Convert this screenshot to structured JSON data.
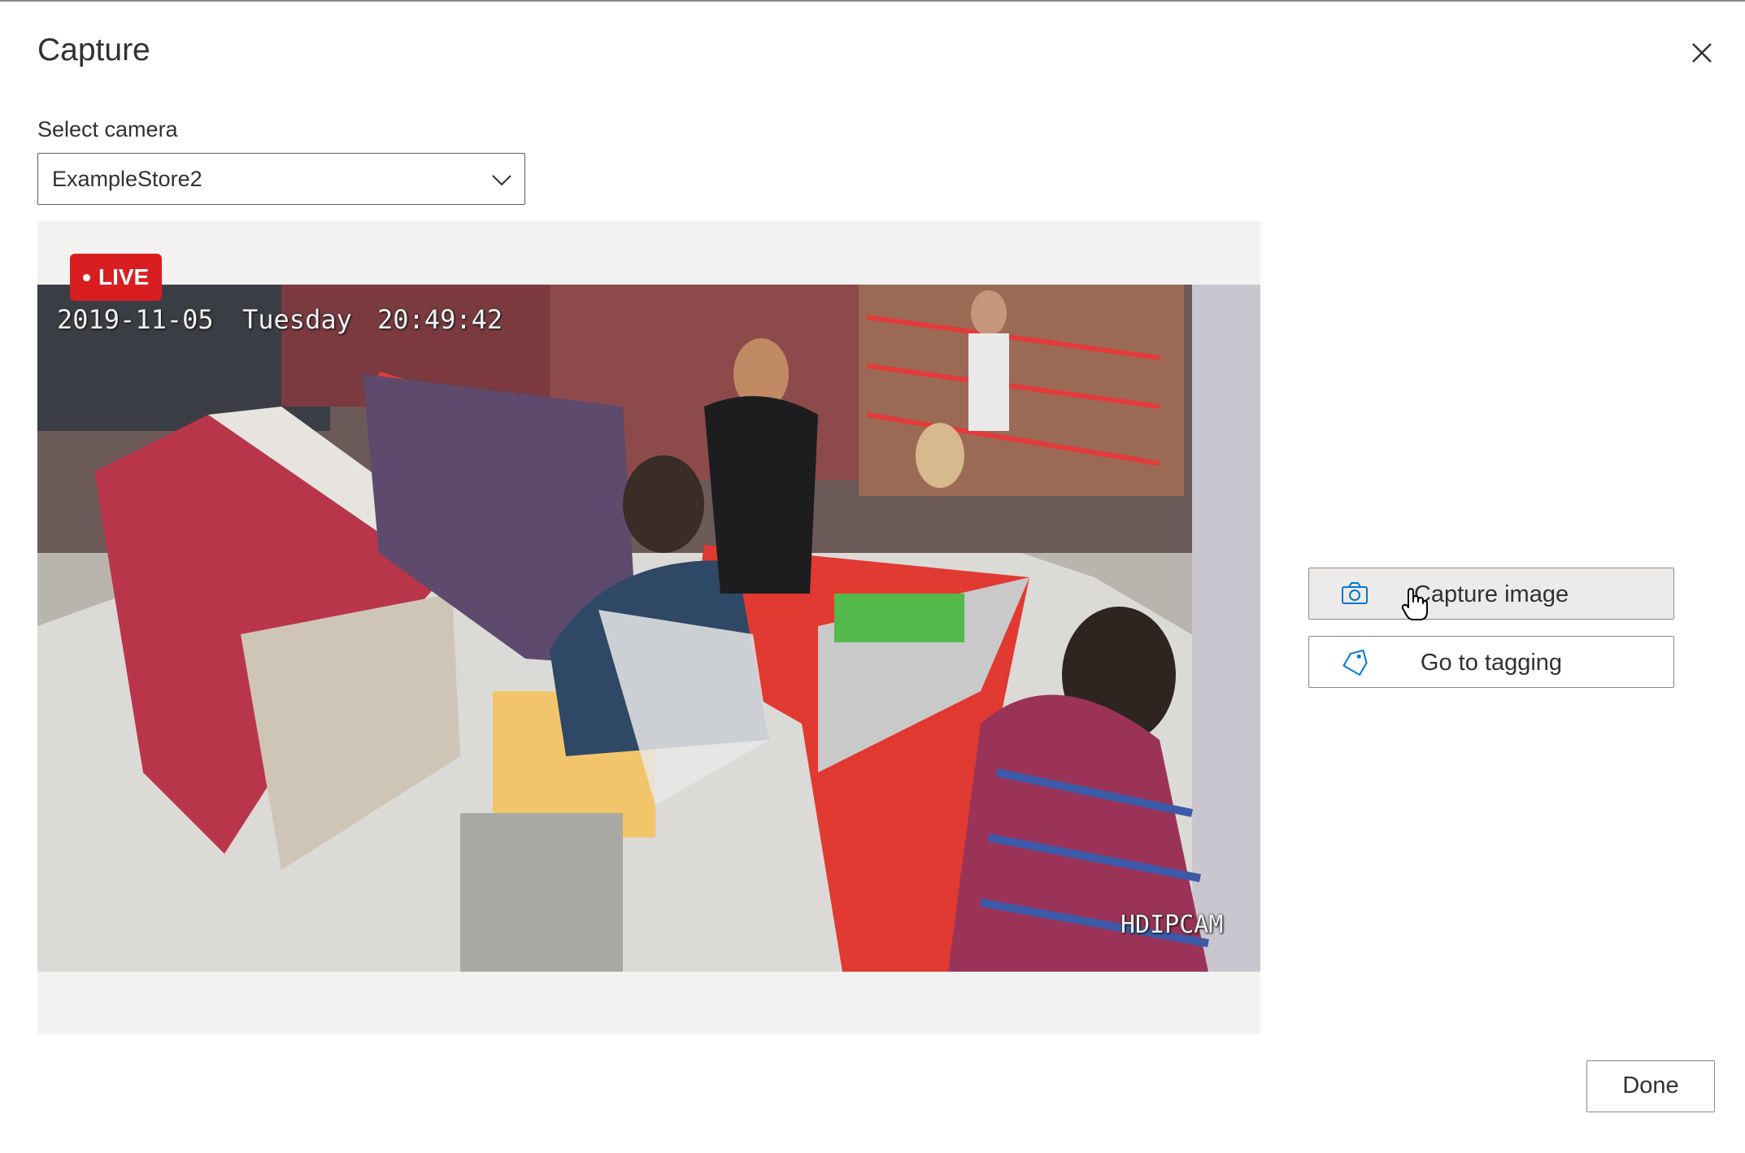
{
  "dialog": {
    "title": "Capture",
    "close_icon": "close-icon"
  },
  "camera": {
    "label": "Select camera",
    "selected": "ExampleStore2",
    "dropdown_icon": "chevron-down-icon"
  },
  "feed": {
    "live_label": "LIVE",
    "date_text": "2019-11-05",
    "day_text": "Tuesday",
    "time_text": "20:49:42",
    "watermark": "HDIPCAM"
  },
  "actions": {
    "capture_label": "Capture image",
    "capture_icon": "camera-icon",
    "tagging_label": "Go to tagging",
    "tagging_icon": "tag-icon",
    "done_label": "Done"
  },
  "colors": {
    "live_badge": "#d91e22",
    "accent": "#0078d4"
  }
}
